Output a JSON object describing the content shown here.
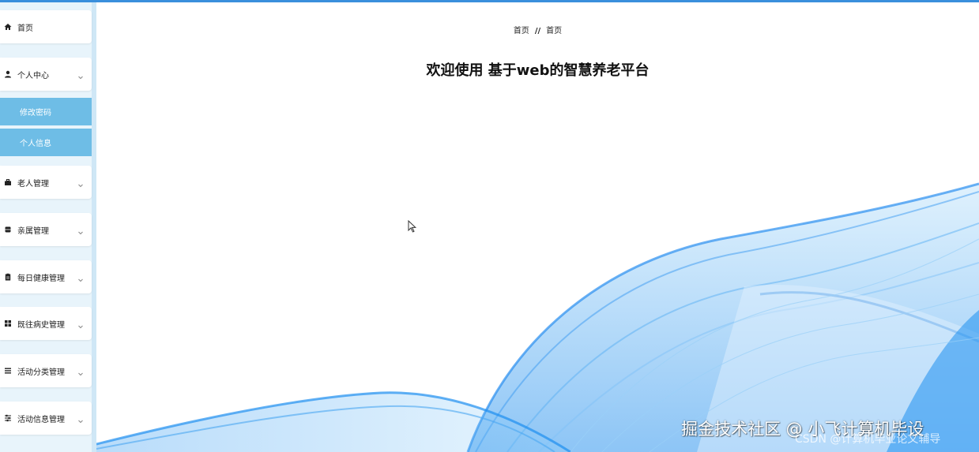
{
  "sidebar": {
    "items": [
      {
        "label": "首页",
        "icon": "home-icon"
      },
      {
        "label": "个人中心",
        "icon": "user-icon",
        "expanded": true,
        "children": [
          {
            "label": "修改密码"
          },
          {
            "label": "个人信息"
          }
        ]
      },
      {
        "label": "老人管理",
        "icon": "briefcase-icon"
      },
      {
        "label": "亲属管理",
        "icon": "database-icon"
      },
      {
        "label": "每日健康管理",
        "icon": "clipboard-icon"
      },
      {
        "label": "既往病史管理",
        "icon": "grid-icon"
      },
      {
        "label": "活动分类管理",
        "icon": "list-icon"
      },
      {
        "label": "活动信息管理",
        "icon": "sliders-icon"
      }
    ]
  },
  "breadcrumb": {
    "first": "首页",
    "separator": "//",
    "second": "首页"
  },
  "main": {
    "welcome": "欢迎使用 基于web的智慧养老平台"
  },
  "watermark": {
    "line1": "掘金技术社区 @ 小飞计算机毕设",
    "line2": "CSDN @计算机毕业论文辅导"
  },
  "colors": {
    "accent": "#3a8fdc",
    "submenu": "#6ebde6",
    "wave": "#1e8ff0"
  }
}
